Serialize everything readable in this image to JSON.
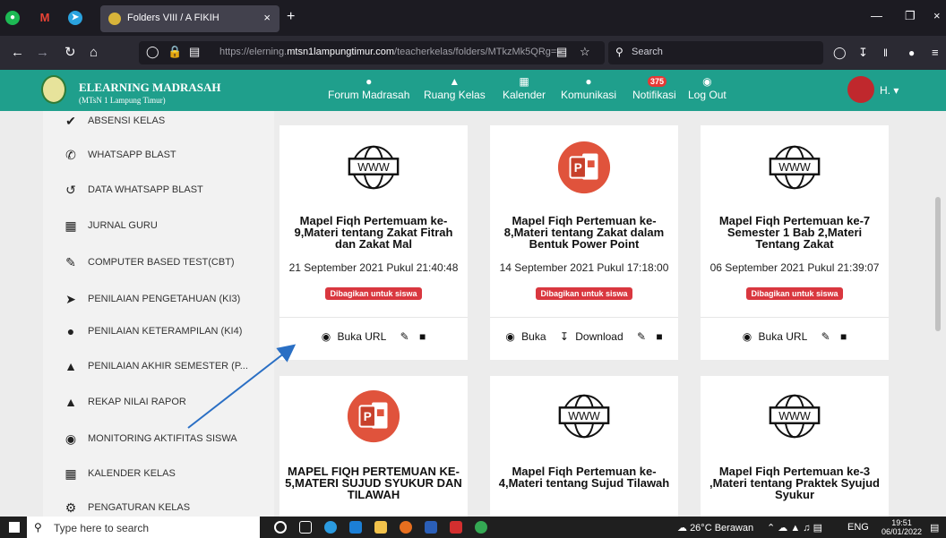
{
  "browser": {
    "tab_title": "Folders VIII / A FIKIH",
    "url_prefix": "https://elerning.",
    "url_host": "mtsn1lampungtimur.com",
    "url_path": "/teacherkelas/folders/MTkzMk5QRg==",
    "search_placeholder": "Search"
  },
  "site": {
    "brand": "ELEARNING MADRASAH",
    "subbrand": "(MTsN 1 Lampung Timur)",
    "nav": [
      {
        "label": "Forum Madrasah",
        "icon": "chat-icon"
      },
      {
        "label": "Ruang Kelas",
        "icon": "graduation-cap-icon"
      },
      {
        "label": "Kalender",
        "icon": "calendar-icon"
      },
      {
        "label": "Komunikasi",
        "icon": "user-icon"
      },
      {
        "label": "Notifikasi",
        "icon": "megaphone-icon"
      },
      {
        "label": "Log Out",
        "icon": "chevron-circle-icon"
      }
    ],
    "notif_count": "375",
    "user_name": "H."
  },
  "sidebar": {
    "items": [
      {
        "label": "ABSENSI KELAS",
        "icon": "check-icon"
      },
      {
        "label": "WHATSAPP BLAST",
        "icon": "phone-icon"
      },
      {
        "label": "DATA WHATSAPP BLAST",
        "icon": "history-icon"
      },
      {
        "label": "JURNAL GURU",
        "icon": "calendar-icon"
      },
      {
        "label": "COMPUTER BASED TEST(CBT)",
        "icon": "edit-icon"
      },
      {
        "label": "PENILAIAN PENGETAHUAN (KI3)",
        "icon": "rocket-icon"
      },
      {
        "label": "PENILAIAN KETERAMPILAN (KI4)",
        "icon": "users-icon"
      },
      {
        "label": "PENILAIAN AKHIR SEMESTER (P...",
        "icon": "user-secret-icon"
      },
      {
        "label": "REKAP NILAI RAPOR",
        "icon": "graduation-cap-icon"
      },
      {
        "label": "MONITORING AKTIFITAS SISWA",
        "icon": "motorcycle-icon"
      },
      {
        "label": "KALENDER KELAS",
        "icon": "calendar-icon"
      },
      {
        "label": "PENGATURAN KELAS",
        "icon": "gear-icon"
      }
    ]
  },
  "cards": [
    {
      "type": "url",
      "title": "Mapel Fiqh Pertemuam ke-9,Materi tentang Zakat Fitrah dan Zakat Mal",
      "date": "21 September 2021 Pukul 21:40:48",
      "badge": "Dibagikan untuk siswa",
      "open_label": "Buka URL",
      "download_label": ""
    },
    {
      "type": "ppt",
      "title": "Mapel Fiqh Pertemuan ke-8,Materi tentang Zakat dalam Bentuk Power Point",
      "date": "14 September 2021 Pukul 17:18:00",
      "badge": "Dibagikan untuk siswa",
      "open_label": "Buka",
      "download_label": "Download"
    },
    {
      "type": "url",
      "title": "Mapel Fiqh Pertemuan ke-7 Semester 1 Bab 2,Materi Tentang Zakat",
      "date": "06 September 2021 Pukul 21:39:07",
      "badge": "Dibagikan untuk siswa",
      "open_label": "Buka URL",
      "download_label": ""
    },
    {
      "type": "ppt",
      "title": "MAPEL FIQH PERTEMUAN KE-5,MATERI SUJUD SYUKUR DAN TILAWAH",
      "date": "",
      "badge": "",
      "open_label": "",
      "download_label": ""
    },
    {
      "type": "url",
      "title": "Mapel Fiqh Pertemuan ke-4,Materi tentang Sujud Tilawah",
      "date": "",
      "badge": "",
      "open_label": "",
      "download_label": ""
    },
    {
      "type": "url",
      "title": "Mapel Fiqh Pertemuan ke-3 ,Materi tentang Praktek Syujud Syukur",
      "date": "",
      "badge": "",
      "open_label": "",
      "download_label": ""
    }
  ],
  "taskbar": {
    "search_placeholder": "Type here to search",
    "weather": "26°C Berawan",
    "lang": "ENG",
    "time": "19:51",
    "date": "06/01/2022"
  },
  "colors": {
    "header": "#1f9f8c",
    "badge": "#d9373f",
    "ppt": "#e0533c",
    "arrow": "#2a6fc4"
  }
}
